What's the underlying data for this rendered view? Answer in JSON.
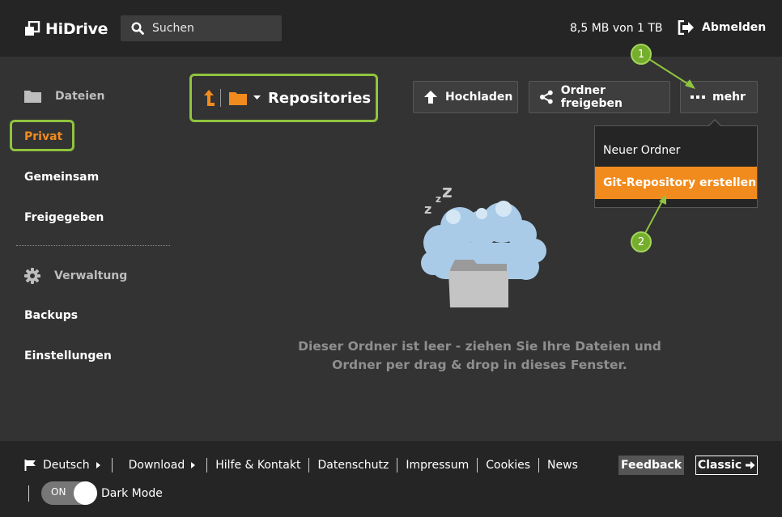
{
  "header": {
    "brand": "HiDrive",
    "search_placeholder": "Suchen",
    "quota": "8,5 MB von 1 TB",
    "logout_label": "Abmelden"
  },
  "sidebar": {
    "files_heading": "Dateien",
    "items": [
      {
        "label": "Privat",
        "active": true
      },
      {
        "label": "Gemeinsam"
      },
      {
        "label": "Freigegeben"
      }
    ],
    "admin_heading": "Verwaltung",
    "admin_items": [
      {
        "label": "Backups"
      },
      {
        "label": "Einstellungen"
      }
    ]
  },
  "breadcrumb": {
    "title": "Repositories"
  },
  "toolbar": {
    "upload_label": "Hochladen",
    "share_label": "Ordner freigeben",
    "more_label": "mehr"
  },
  "more_menu": {
    "items": [
      {
        "label": "Neuer Ordner"
      },
      {
        "label": "Git-Repository erstellen",
        "active": true
      }
    ]
  },
  "empty_state": {
    "message_line1": "Dieser Ordner ist leer - ziehen Sie Ihre Dateien und",
    "message_line2": "Ordner per drag & drop in dieses Fenster."
  },
  "annotations": {
    "step1": "1",
    "step2": "2",
    "color": "#8fc43e"
  },
  "footer": {
    "language": "Deutsch",
    "links": [
      "Download",
      "Hilfe & Kontakt",
      "Datenschutz",
      "Impressum",
      "Cookies",
      "News"
    ],
    "feedback_label": "Feedback",
    "classic_label": "Classic",
    "toggle_state": "ON",
    "dark_mode_label": "Dark Mode"
  },
  "colors": {
    "accent": "#f18b1d",
    "highlight": "#8fc43e",
    "background": "#333333",
    "bar": "#252525"
  }
}
